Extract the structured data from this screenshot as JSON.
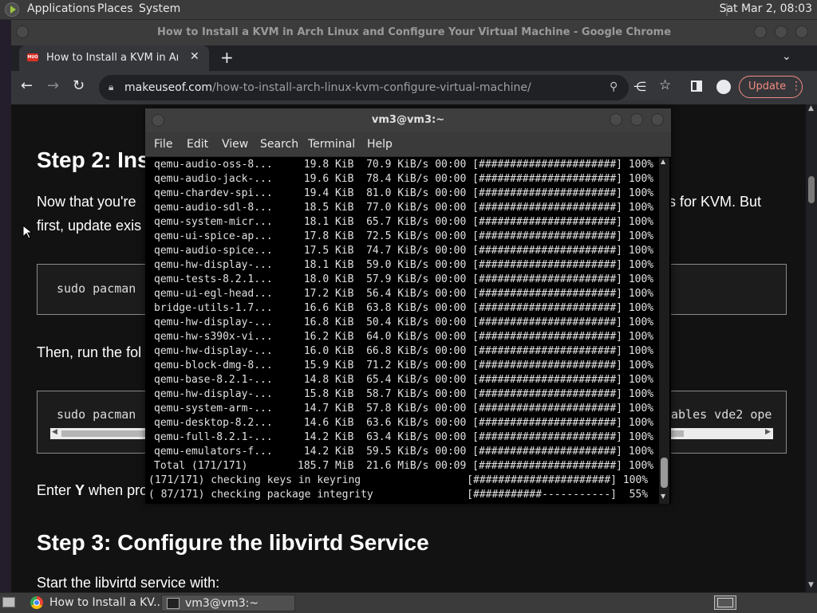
{
  "panel": {
    "menus": [
      "Applications",
      "Places",
      "System"
    ],
    "clock": "Sat Mar 2, 08:03"
  },
  "chrome": {
    "window_title": "How to Install a KVM in Arch Linux and Configure Your Virtual Machine - Google Chrome",
    "tab_title": "How to Install a KVM in Arch Linux and Configure Your Virtual Machine",
    "tab_favicon_text": "MUO",
    "url_host": "makeuseof.com",
    "url_path": "/how-to-install-arch-linux-kvm-configure-virtual-machine/",
    "update_label": "Update"
  },
  "article": {
    "heading_step2": "Step 2: Ins",
    "para1_line1_left": "Now that you're",
    "para1_line1_right": "s for KVM. But",
    "para1_line2": "first, update exis",
    "code1": "sudo pacman -",
    "then_text": "Then, run the fol",
    "code2_left": "sudo pacman -",
    "code2_right": "ables vde2 ope",
    "enter_prefix": "Enter ",
    "enter_key": "Y",
    "enter_suffix": " when pro",
    "heading_step3": "Step 3: Configure the libvirtd Service",
    "start_text": "Start the libvirtd service with:"
  },
  "terminal": {
    "title": "vm3@vm3:~",
    "menus": [
      "File",
      "Edit",
      "View",
      "Search",
      "Terminal",
      "Help"
    ],
    "lines": [
      "qemu-audio-oss-8...     19.8 KiB  70.9 KiB/s 00:00 [######################] 100%",
      "qemu-audio-jack-...     19.6 KiB  78.4 KiB/s 00:00 [######################] 100%",
      "qemu-chardev-spi...     19.4 KiB  81.0 KiB/s 00:00 [######################] 100%",
      "qemu-audio-sdl-8...     18.5 KiB  77.0 KiB/s 00:00 [######################] 100%",
      "qemu-system-micr...     18.1 KiB  65.7 KiB/s 00:00 [######################] 100%",
      "qemu-ui-spice-ap...     17.8 KiB  72.5 KiB/s 00:00 [######################] 100%",
      "qemu-audio-spice...     17.5 KiB  74.7 KiB/s 00:00 [######################] 100%",
      "qemu-hw-display-...     18.1 KiB  59.0 KiB/s 00:00 [######################] 100%",
      "qemu-tests-8.2.1...     18.0 KiB  57.9 KiB/s 00:00 [######################] 100%",
      "qemu-ui-egl-head...     17.2 KiB  56.4 KiB/s 00:00 [######################] 100%",
      "bridge-utils-1.7...     16.6 KiB  63.8 KiB/s 00:00 [######################] 100%",
      "qemu-hw-display-...     16.8 KiB  50.4 KiB/s 00:00 [######################] 100%",
      "qemu-hw-s390x-vi...     16.2 KiB  64.0 KiB/s 00:00 [######################] 100%",
      "qemu-hw-display-...     16.0 KiB  66.8 KiB/s 00:00 [######################] 100%",
      "qemu-block-dmg-8...     15.9 KiB  71.2 KiB/s 00:00 [######################] 100%",
      "qemu-base-8.2.1-...     14.8 KiB  65.4 KiB/s 00:00 [######################] 100%",
      "qemu-hw-display-...     15.8 KiB  58.7 KiB/s 00:00 [######################] 100%",
      "qemu-system-arm-...     14.7 KiB  57.8 KiB/s 00:00 [######################] 100%",
      "qemu-desktop-8.2...     14.6 KiB  63.6 KiB/s 00:00 [######################] 100%",
      "qemu-full-8.2.1-...     14.2 KiB  63.4 KiB/s 00:00 [######################] 100%",
      "qemu-emulators-f...     14.2 KiB  59.5 KiB/s 00:00 [######################] 100%",
      "Total (171/171)        185.7 MiB  21.6 MiB/s 00:09 [######################] 100%",
      "(171/171) checking keys in keyring                 [######################] 100%",
      "( 87/171) checking package integrity               [###########-----------]  55%"
    ]
  },
  "taskbar": {
    "chrome_label": "How to Install a KV...",
    "terminal_label": "vm3@vm3:~"
  }
}
